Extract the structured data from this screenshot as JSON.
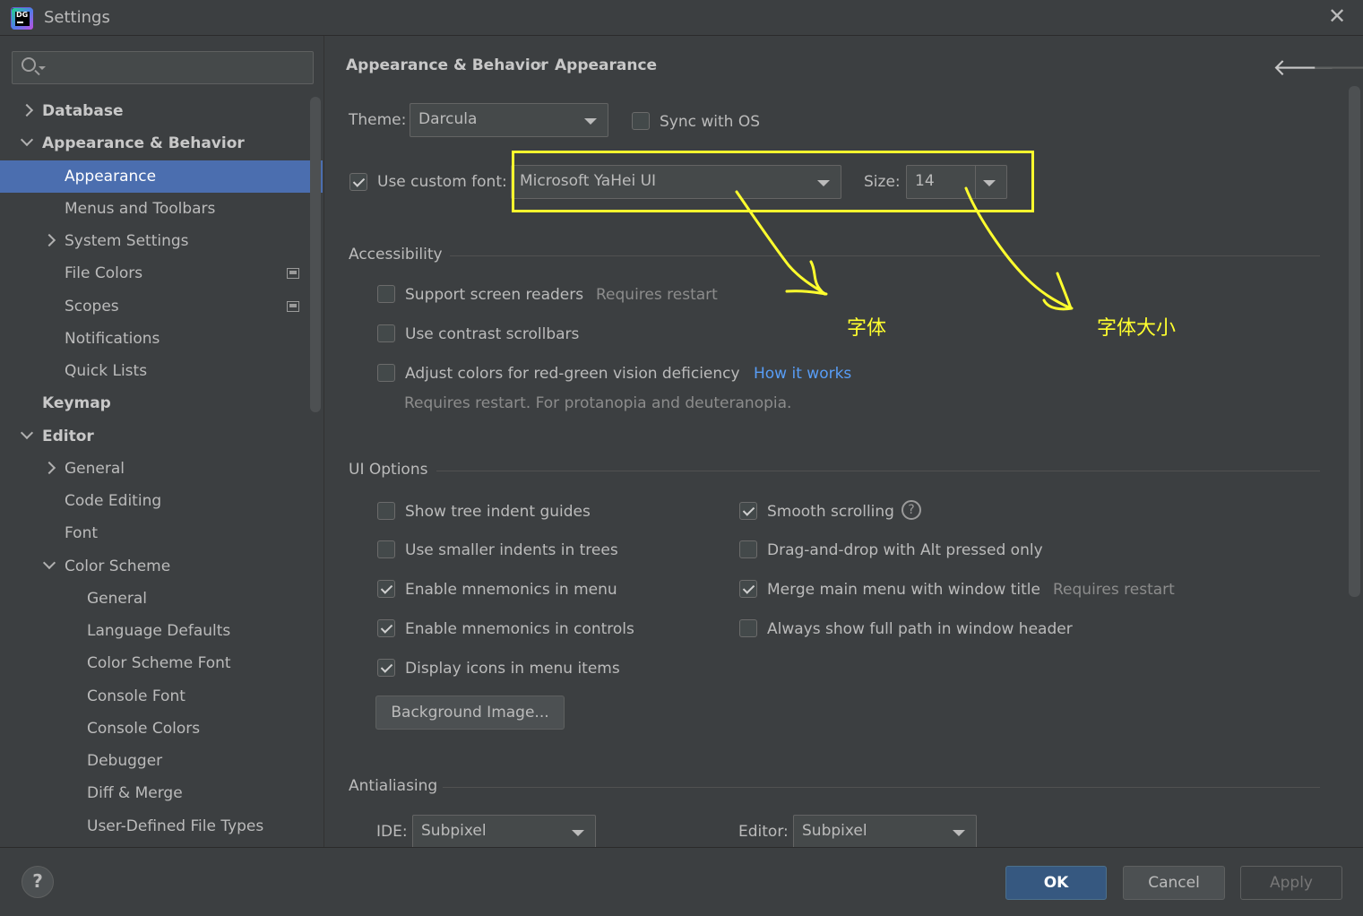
{
  "window": {
    "title": "Settings",
    "close_glyph": "✕",
    "icon": "datagrip-app-icon",
    "icon_text": "DG"
  },
  "search": {
    "placeholder": "",
    "value": ""
  },
  "sidebar": {
    "items": [
      {
        "label": "Database",
        "level": 0,
        "bold": true,
        "expand": "collapsed"
      },
      {
        "label": "Appearance & Behavior",
        "level": 0,
        "bold": true,
        "expand": "expanded"
      },
      {
        "label": "Appearance",
        "level": 1,
        "selected": true
      },
      {
        "label": "Menus and Toolbars",
        "level": 1
      },
      {
        "label": "System Settings",
        "level": 1,
        "expand": "collapsed"
      },
      {
        "label": "File Colors",
        "level": 1,
        "project_icon": true
      },
      {
        "label": "Scopes",
        "level": 1,
        "project_icon": true
      },
      {
        "label": "Notifications",
        "level": 1
      },
      {
        "label": "Quick Lists",
        "level": 1
      },
      {
        "label": "Keymap",
        "level": 0,
        "bold": true
      },
      {
        "label": "Editor",
        "level": 0,
        "bold": true,
        "expand": "expanded"
      },
      {
        "label": "General",
        "level": 1,
        "expand": "collapsed"
      },
      {
        "label": "Code Editing",
        "level": 1
      },
      {
        "label": "Font",
        "level": 1
      },
      {
        "label": "Color Scheme",
        "level": 1,
        "expand": "expanded"
      },
      {
        "label": "General",
        "level": 2
      },
      {
        "label": "Language Defaults",
        "level": 2
      },
      {
        "label": "Color Scheme Font",
        "level": 2
      },
      {
        "label": "Console Font",
        "level": 2
      },
      {
        "label": "Console Colors",
        "level": 2
      },
      {
        "label": "Debugger",
        "level": 2
      },
      {
        "label": "Diff & Merge",
        "level": 2
      },
      {
        "label": "User-Defined File Types",
        "level": 2
      }
    ]
  },
  "breadcrumb": {
    "parent": "Appearance & Behavior",
    "separator": "›",
    "current": "Appearance",
    "back_glyph": "🡐",
    "forward_glyph": "🡒"
  },
  "theme": {
    "label": "Theme:",
    "value": "Darcula",
    "sync_label": "Sync with OS",
    "sync_checked": false
  },
  "custom_font": {
    "label": "Use custom font:",
    "checked": true,
    "font_value": "Microsoft YaHei UI",
    "size_label": "Size:",
    "size_value": "14"
  },
  "accessibility": {
    "title": "Accessibility",
    "screen_readers": {
      "label": "Support screen readers",
      "hint": "Requires restart",
      "checked": false
    },
    "contrast_scrollbars": {
      "label": "Use contrast scrollbars",
      "checked": false
    },
    "red_green": {
      "label": "Adjust colors for red-green vision deficiency",
      "link": "How it works",
      "hint": "Requires restart. For protanopia and deuteranopia.",
      "checked": false
    }
  },
  "ui_options": {
    "title": "UI Options",
    "left": [
      {
        "label": "Show tree indent guides",
        "checked": false
      },
      {
        "label": "Use smaller indents in trees",
        "checked": false
      },
      {
        "label": "Enable mnemonics in menu",
        "checked": true
      },
      {
        "label": "Enable mnemonics in controls",
        "checked": true
      },
      {
        "label": "Display icons in menu items",
        "checked": true
      }
    ],
    "right": [
      {
        "label": "Smooth scrolling",
        "checked": true,
        "help": "?"
      },
      {
        "label": "Drag-and-drop with Alt pressed only",
        "checked": false
      },
      {
        "label": "Merge main menu with window title",
        "checked": true,
        "hint": "Requires restart"
      },
      {
        "label": "Always show full path in window header",
        "checked": false
      }
    ],
    "background_button": "Background Image..."
  },
  "antialiasing": {
    "title": "Antialiasing",
    "ide_label": "IDE:",
    "ide_value": "Subpixel",
    "editor_label": "Editor:",
    "editor_value": "Subpixel"
  },
  "footer": {
    "help": "?",
    "ok": "OK",
    "cancel": "Cancel",
    "apply": "Apply"
  },
  "annotation": {
    "color": "#ffff2e",
    "font_note": "字体",
    "size_note": "字体大小"
  },
  "colors": {
    "background": "#3c3f41",
    "selection": "#4b6eaf",
    "ok_button": "#365880",
    "link": "#589df6"
  }
}
